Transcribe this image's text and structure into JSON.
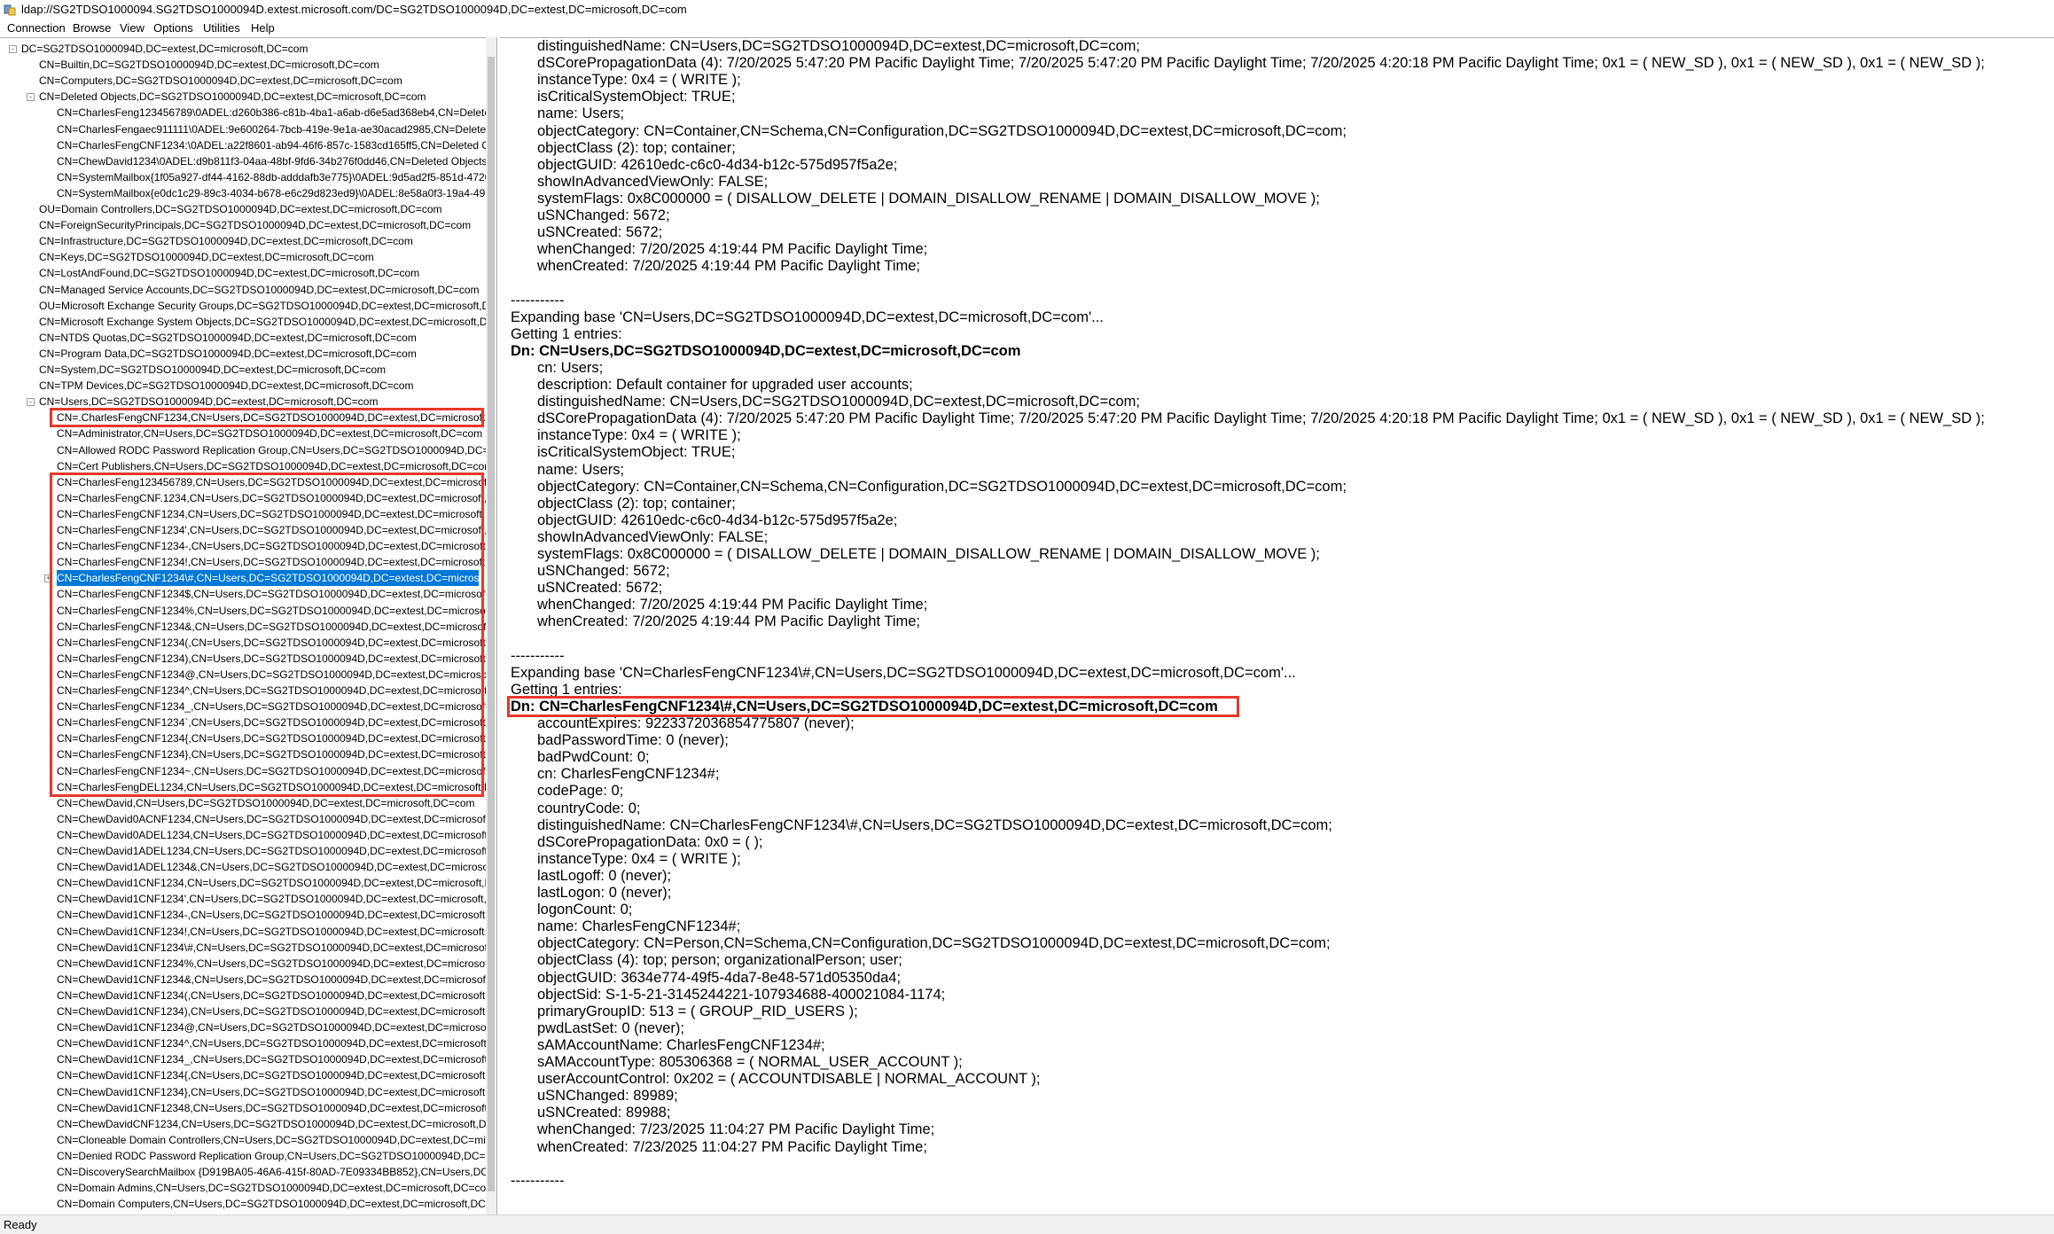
{
  "window": {
    "title": "ldap://SG2TDSO1000094.SG2TDSO1000094D.extest.microsoft.com/DC=SG2TDSO1000094D,DC=extest,DC=microsoft,DC=com",
    "icon": "ldp-app-icon"
  },
  "menu": [
    "Connection",
    "Browse",
    "View",
    "Options",
    "Utilities",
    "Help"
  ],
  "tree": {
    "items": [
      {
        "label": "DC=SG2TDSO1000094D,DC=extest,DC=microsoft,DC=com",
        "expander": "-"
      },
      {
        "label": "CN=Builtin,DC=SG2TDSO1000094D,DC=extest,DC=microsoft,DC=com"
      },
      {
        "label": "CN=Computers,DC=SG2TDSO1000094D,DC=extest,DC=microsoft,DC=com"
      },
      {
        "label": "CN=Deleted Objects,DC=SG2TDSO1000094D,DC=extest,DC=microsoft,DC=com",
        "expander": "-"
      },
      {
        "label": "CN=CharlesFeng123456789\\0ADEL:d260b386-c81b-4ba1-a6ab-d6e5ad368eb4,CN=Deleted"
      },
      {
        "label": "CN=CharlesFengaec911111\\0ADEL:9e600264-7bcb-419e-9e1a-ae30acad2985,CN=Deleted O"
      },
      {
        "label": "CN=CharlesFengCNF1234:\\0ADEL:a22f8601-ab94-46f6-857c-1583cd165ff5,CN=Deleted Ob"
      },
      {
        "label": "CN=ChewDavid1234\\0ADEL:d9b811f3-04aa-48bf-9fd6-34b276f0dd46,CN=Deleted Objects,"
      },
      {
        "label": "CN=SystemMailbox{1f05a927-df44-4162-88db-adddafb3e775}\\0ADEL:9d5ad2f5-851d-4720"
      },
      {
        "label": "CN=SystemMailbox{e0dc1c29-89c3-4034-b678-e6c29d823ed9}\\0ADEL:8e58a0f3-19a4-49c6"
      },
      {
        "label": "OU=Domain Controllers,DC=SG2TDSO1000094D,DC=extest,DC=microsoft,DC=com"
      },
      {
        "label": "CN=ForeignSecurityPrincipals,DC=SG2TDSO1000094D,DC=extest,DC=microsoft,DC=com"
      },
      {
        "label": "CN=Infrastructure,DC=SG2TDSO1000094D,DC=extest,DC=microsoft,DC=com"
      },
      {
        "label": "CN=Keys,DC=SG2TDSO1000094D,DC=extest,DC=microsoft,DC=com"
      },
      {
        "label": "CN=LostAndFound,DC=SG2TDSO1000094D,DC=extest,DC=microsoft,DC=com"
      },
      {
        "label": "CN=Managed Service Accounts,DC=SG2TDSO1000094D,DC=extest,DC=microsoft,DC=com"
      },
      {
        "label": "OU=Microsoft Exchange Security Groups,DC=SG2TDSO1000094D,DC=extest,DC=microsoft,DC"
      },
      {
        "label": "CN=Microsoft Exchange System Objects,DC=SG2TDSO1000094D,DC=extest,DC=microsoft,DC"
      },
      {
        "label": "CN=NTDS Quotas,DC=SG2TDSO1000094D,DC=extest,DC=microsoft,DC=com"
      },
      {
        "label": "CN=Program Data,DC=SG2TDSO1000094D,DC=extest,DC=microsoft,DC=com"
      },
      {
        "label": "CN=System,DC=SG2TDSO1000094D,DC=extest,DC=microsoft,DC=com"
      },
      {
        "label": "CN=TPM Devices,DC=SG2TDSO1000094D,DC=extest,DC=microsoft,DC=com"
      },
      {
        "label": "CN=Users,DC=SG2TDSO1000094D,DC=extest,DC=microsoft,DC=com",
        "expander": "-"
      },
      {
        "label": "CN=.CharlesFengCNF1234,CN=Users,DC=SG2TDSO1000094D,DC=extest,DC=microsoft,DC"
      },
      {
        "label": "CN=Administrator,CN=Users,DC=SG2TDSO1000094D,DC=extest,DC=microsoft,DC=com"
      },
      {
        "label": "CN=Allowed RODC Password Replication Group,CN=Users,DC=SG2TDSO1000094D,DC=ex"
      },
      {
        "label": "CN=Cert Publishers,CN=Users,DC=SG2TDSO1000094D,DC=extest,DC=microsoft,DC=com"
      },
      {
        "label": "CN=CharlesFeng123456789,CN=Users,DC=SG2TDSO1000094D,DC=extest,DC=microsoft,DC"
      },
      {
        "label": "CN=CharlesFengCNF.1234,CN=Users,DC=SG2TDSO1000094D,DC=extest,DC=microsoft,DC"
      },
      {
        "label": "CN=CharlesFengCNF1234,CN=Users,DC=SG2TDSO1000094D,DC=extest,DC=microsoft,DC="
      },
      {
        "label": "CN=CharlesFengCNF1234',CN=Users,DC=SG2TDSO1000094D,DC=extest,DC=microsoft,DC"
      },
      {
        "label": "CN=CharlesFengCNF1234-,CN=Users,DC=SG2TDSO1000094D,DC=extest,DC=microsoft,DC"
      },
      {
        "label": "CN=CharlesFengCNF1234!,CN=Users,DC=SG2TDSO1000094D,DC=extest,DC=microsoft,DC"
      },
      {
        "label": "CN=CharlesFengCNF1234\\#,CN=Users,DC=SG2TDSO1000094D,DC=extest,DC=microsoft,D",
        "selected": true,
        "expander": "+"
      },
      {
        "label": "CN=CharlesFengCNF1234$,CN=Users,DC=SG2TDSO1000094D,DC=extest,DC=microsoft,DC"
      },
      {
        "label": "CN=CharlesFengCNF1234%,CN=Users,DC=SG2TDSO1000094D,DC=extest,DC=microsoft,D"
      },
      {
        "label": "CN=CharlesFengCNF1234&,CN=Users,DC=SG2TDSO1000094D,DC=extest,DC=microsoft,D"
      },
      {
        "label": "CN=CharlesFengCNF1234(,CN=Users,DC=SG2TDSO1000094D,DC=extest,DC=microsoft,DC"
      },
      {
        "label": "CN=CharlesFengCNF1234),CN=Users,DC=SG2TDSO1000094D,DC=extest,DC=microsoft,DC"
      },
      {
        "label": "CN=CharlesFengCNF1234@,CN=Users,DC=SG2TDSO1000094D,DC=extest,DC=microsoft,D"
      },
      {
        "label": "CN=CharlesFengCNF1234^,CN=Users,DC=SG2TDSO1000094D,DC=extest,DC=microsoft,D"
      },
      {
        "label": "CN=CharlesFengCNF1234_,CN=Users,DC=SG2TDSO1000094D,DC=extest,DC=microsoft,DC"
      },
      {
        "label": "CN=CharlesFengCNF1234`,CN=Users,DC=SG2TDSO1000094D,DC=extest,DC=microsoft,DC"
      },
      {
        "label": "CN=CharlesFengCNF1234{,CN=Users,DC=SG2TDSO1000094D,DC=extest,DC=microsoft,DC"
      },
      {
        "label": "CN=CharlesFengCNF1234},CN=Users,DC=SG2TDSO1000094D,DC=extest,DC=microsoft,DC"
      },
      {
        "label": "CN=CharlesFengCNF1234~,CN=Users,DC=SG2TDSO1000094D,DC=extest,DC=microsoft,D"
      },
      {
        "label": "CN=CharlesFengDEL1234,CN=Users,DC=SG2TDSO1000094D,DC=extest,DC=microsoft,DC="
      },
      {
        "label": "CN=ChewDavid,CN=Users,DC=SG2TDSO1000094D,DC=extest,DC=microsoft,DC=com"
      },
      {
        "label": "CN=ChewDavid0ACNF1234,CN=Users,DC=SG2TDSO1000094D,DC=extest,DC=microsoft,D"
      },
      {
        "label": "CN=ChewDavid0ADEL1234,CN=Users,DC=SG2TDSO1000094D,DC=extest,DC=microsoft,D"
      },
      {
        "label": "CN=ChewDavid1ADEL1234,CN=Users,DC=SG2TDSO1000094D,DC=extest,DC=microsoft,D"
      },
      {
        "label": "CN=ChewDavid1ADEL1234&,CN=Users,DC=SG2TDSO1000094D,DC=extest,DC=microsoft,I"
      },
      {
        "label": "CN=ChewDavid1CNF1234,CN=Users,DC=SG2TDSO1000094D,DC=extest,DC=microsoft,DC"
      },
      {
        "label": "CN=ChewDavid1CNF1234',CN=Users,DC=SG2TDSO1000094D,DC=extest,DC=microsoft,DC"
      },
      {
        "label": "CN=ChewDavid1CNF1234-,CN=Users,DC=SG2TDSO1000094D,DC=extest,DC=microsoft,DC"
      },
      {
        "label": "CN=ChewDavid1CNF1234!,CN=Users,DC=SG2TDSO1000094D,DC=extest,DC=microsoft,DC"
      },
      {
        "label": "CN=ChewDavid1CNF1234\\#,CN=Users,DC=SG2TDSO1000094D,DC=extest,DC=microsoft,D"
      },
      {
        "label": "CN=ChewDavid1CNF1234%,CN=Users,DC=SG2TDSO1000094D,DC=extest,DC=microsoft,DC"
      },
      {
        "label": "CN=ChewDavid1CNF1234&,CN=Users,DC=SG2TDSO1000094D,DC=extest,DC=microsoft,D"
      },
      {
        "label": "CN=ChewDavid1CNF1234(,CN=Users,DC=SG2TDSO1000094D,DC=extest,DC=microsoft,DC"
      },
      {
        "label": "CN=ChewDavid1CNF1234),CN=Users,DC=SG2TDSO1000094D,DC=extest,DC=microsoft,DC"
      },
      {
        "label": "CN=ChewDavid1CNF1234@,CN=Users,DC=SG2TDSO1000094D,DC=extest,DC=microsoft,D"
      },
      {
        "label": "CN=ChewDavid1CNF1234^,CN=Users,DC=SG2TDSO1000094D,DC=extest,DC=microsoft,D"
      },
      {
        "label": "CN=ChewDavid1CNF1234_,CN=Users,DC=SG2TDSO1000094D,DC=extest,DC=microsoft,DC"
      },
      {
        "label": "CN=ChewDavid1CNF1234{,CN=Users,DC=SG2TDSO1000094D,DC=extest,DC=microsoft,DC"
      },
      {
        "label": "CN=ChewDavid1CNF1234},CN=Users,DC=SG2TDSO1000094D,DC=extest,DC=microsoft,DC"
      },
      {
        "label": "CN=ChewDavid1CNF12348,CN=Users,DC=SG2TDSO1000094D,DC=extest,DC=microsoft,D"
      },
      {
        "label": "CN=ChewDavidCNF1234,CN=Users,DC=SG2TDSO1000094D,DC=extest,DC=microsoft,DC=c"
      },
      {
        "label": "CN=Cloneable Domain Controllers,CN=Users,DC=SG2TDSO1000094D,DC=extest,DC=micr"
      },
      {
        "label": "CN=Denied RODC Password Replication Group,CN=Users,DC=SG2TDSO1000094D,DC=exte"
      },
      {
        "label": "CN=DiscoverySearchMailbox {D919BA05-46A6-415f-80AD-7E09334BB852},CN=Users,DC=S"
      },
      {
        "label": "CN=Domain Admins,CN=Users,DC=SG2TDSO1000094D,DC=extest,DC=microsoft,DC=com"
      },
      {
        "label": "CN=Domain Computers,CN=Users,DC=SG2TDSO1000094D,DC=extest,DC=microsoft,DC="
      }
    ]
  },
  "details": {
    "lines": [
      {
        "text": "distinguishedName: CN=Users,DC=SG2TDSO1000094D,DC=extest,DC=microsoft,DC=com;",
        "indent": true
      },
      {
        "text": "dSCorePropagationData (4): 7/20/2025 5:47:20 PM Pacific Daylight Time; 7/20/2025 5:47:20 PM Pacific Daylight Time; 7/20/2025 4:20:18 PM Pacific Daylight Time; 0x1 = ( NEW_SD ), 0x1 = ( NEW_SD ), 0x1 = ( NEW_SD );",
        "indent": true
      },
      {
        "text": "instanceType: 0x4 = ( WRITE );",
        "indent": true
      },
      {
        "text": "isCriticalSystemObject: TRUE;",
        "indent": true
      },
      {
        "text": "name: Users;",
        "indent": true
      },
      {
        "text": "objectCategory: CN=Container,CN=Schema,CN=Configuration,DC=SG2TDSO1000094D,DC=extest,DC=microsoft,DC=com;",
        "indent": true
      },
      {
        "text": "objectClass (2): top; container;",
        "indent": true
      },
      {
        "text": "objectGUID: 42610edc-c6c0-4d34-b12c-575d957f5a2e;",
        "indent": true
      },
      {
        "text": "showInAdvancedViewOnly: FALSE;",
        "indent": true
      },
      {
        "text": "systemFlags: 0x8C000000 = ( DISALLOW_DELETE | DOMAIN_DISALLOW_RENAME | DOMAIN_DISALLOW_MOVE );",
        "indent": true
      },
      {
        "text": "uSNChanged: 5672;",
        "indent": true
      },
      {
        "text": "uSNCreated: 5672;",
        "indent": true
      },
      {
        "text": "whenChanged: 7/20/2025 4:19:44 PM Pacific Daylight Time;",
        "indent": true
      },
      {
        "text": "whenCreated: 7/20/2025 4:19:44 PM Pacific Daylight Time;",
        "indent": true
      },
      {
        "text": ""
      },
      {
        "text": "-----------"
      },
      {
        "text": "Expanding base 'CN=Users,DC=SG2TDSO1000094D,DC=extest,DC=microsoft,DC=com'..."
      },
      {
        "text": "Getting 1 entries:"
      },
      {
        "text": "Dn: CN=Users,DC=SG2TDSO1000094D,DC=extest,DC=microsoft,DC=com",
        "bold": true
      },
      {
        "text": "cn: Users;",
        "indent": true
      },
      {
        "text": "description: Default container for upgraded user accounts;",
        "indent": true
      },
      {
        "text": "distinguishedName: CN=Users,DC=SG2TDSO1000094D,DC=extest,DC=microsoft,DC=com;",
        "indent": true
      },
      {
        "text": "dSCorePropagationData (4): 7/20/2025 5:47:20 PM Pacific Daylight Time; 7/20/2025 5:47:20 PM Pacific Daylight Time; 7/20/2025 4:20:18 PM Pacific Daylight Time; 0x1 = ( NEW_SD ), 0x1 = ( NEW_SD ), 0x1 = ( NEW_SD );",
        "indent": true
      },
      {
        "text": "instanceType: 0x4 = ( WRITE );",
        "indent": true
      },
      {
        "text": "isCriticalSystemObject: TRUE;",
        "indent": true
      },
      {
        "text": "name: Users;",
        "indent": true
      },
      {
        "text": "objectCategory: CN=Container,CN=Schema,CN=Configuration,DC=SG2TDSO1000094D,DC=extest,DC=microsoft,DC=com;",
        "indent": true
      },
      {
        "text": "objectClass (2): top; container;",
        "indent": true
      },
      {
        "text": "objectGUID: 42610edc-c6c0-4d34-b12c-575d957f5a2e;",
        "indent": true
      },
      {
        "text": "showInAdvancedViewOnly: FALSE;",
        "indent": true
      },
      {
        "text": "systemFlags: 0x8C000000 = ( DISALLOW_DELETE | DOMAIN_DISALLOW_RENAME | DOMAIN_DISALLOW_MOVE );",
        "indent": true
      },
      {
        "text": "uSNChanged: 5672;",
        "indent": true
      },
      {
        "text": "uSNCreated: 5672;",
        "indent": true
      },
      {
        "text": "whenChanged: 7/20/2025 4:19:44 PM Pacific Daylight Time;",
        "indent": true
      },
      {
        "text": "whenCreated: 7/20/2025 4:19:44 PM Pacific Daylight Time;",
        "indent": true
      },
      {
        "text": ""
      },
      {
        "text": "-----------"
      },
      {
        "text": "Expanding base 'CN=CharlesFengCNF1234\\#,CN=Users,DC=SG2TDSO1000094D,DC=extest,DC=microsoft,DC=com'..."
      },
      {
        "text": "Getting 1 entries:"
      },
      {
        "text": "Dn: CN=CharlesFengCNF1234\\#,CN=Users,DC=SG2TDSO1000094D,DC=extest,DC=microsoft,DC=com",
        "bold": true,
        "highlight": true
      },
      {
        "text": "accountExpires: 9223372036854775807 (never);",
        "indent": true
      },
      {
        "text": "badPasswordTime: 0 (never);",
        "indent": true
      },
      {
        "text": "badPwdCount: 0;",
        "indent": true
      },
      {
        "text": "cn: CharlesFengCNF1234#;",
        "indent": true
      },
      {
        "text": "codePage: 0;",
        "indent": true
      },
      {
        "text": "countryCode: 0;",
        "indent": true
      },
      {
        "text": "distinguishedName: CN=CharlesFengCNF1234\\#,CN=Users,DC=SG2TDSO1000094D,DC=extest,DC=microsoft,DC=com;",
        "indent": true
      },
      {
        "text": "dSCorePropagationData: 0x0 = (  );",
        "indent": true
      },
      {
        "text": "instanceType: 0x4 = ( WRITE );",
        "indent": true
      },
      {
        "text": "lastLogoff: 0 (never);",
        "indent": true
      },
      {
        "text": "lastLogon: 0 (never);",
        "indent": true
      },
      {
        "text": "logonCount: 0;",
        "indent": true
      },
      {
        "text": "name: CharlesFengCNF1234#;",
        "indent": true
      },
      {
        "text": "objectCategory: CN=Person,CN=Schema,CN=Configuration,DC=SG2TDSO1000094D,DC=extest,DC=microsoft,DC=com;",
        "indent": true
      },
      {
        "text": "objectClass (4): top; person; organizationalPerson; user;",
        "indent": true
      },
      {
        "text": "objectGUID: 3634e774-49f5-4da7-8e48-571d05350da4;",
        "indent": true
      },
      {
        "text": "objectSid: S-1-5-21-3145244221-107934688-400021084-1174;",
        "indent": true
      },
      {
        "text": "primaryGroupID: 513 = ( GROUP_RID_USERS );",
        "indent": true
      },
      {
        "text": "pwdLastSet: 0 (never);",
        "indent": true
      },
      {
        "text": "sAMAccountName: CharlesFengCNF1234#;",
        "indent": true
      },
      {
        "text": "sAMAccountType: 805306368 = ( NORMAL_USER_ACCOUNT );",
        "indent": true
      },
      {
        "text": "userAccountControl: 0x202 = ( ACCOUNTDISABLE | NORMAL_ACCOUNT );",
        "indent": true
      },
      {
        "text": "uSNChanged: 89989;",
        "indent": true
      },
      {
        "text": "uSNCreated: 89988;",
        "indent": true
      },
      {
        "text": "whenChanged: 7/23/2025 11:04:27 PM Pacific Daylight Time;",
        "indent": true
      },
      {
        "text": "whenCreated: 7/23/2025 11:04:27 PM Pacific Daylight Time;",
        "indent": true
      },
      {
        "text": ""
      },
      {
        "text": "-----------"
      }
    ]
  },
  "status": {
    "text": "Ready"
  },
  "colors": {
    "selection": "#0078d7",
    "highlight_box": "#e8372c"
  }
}
